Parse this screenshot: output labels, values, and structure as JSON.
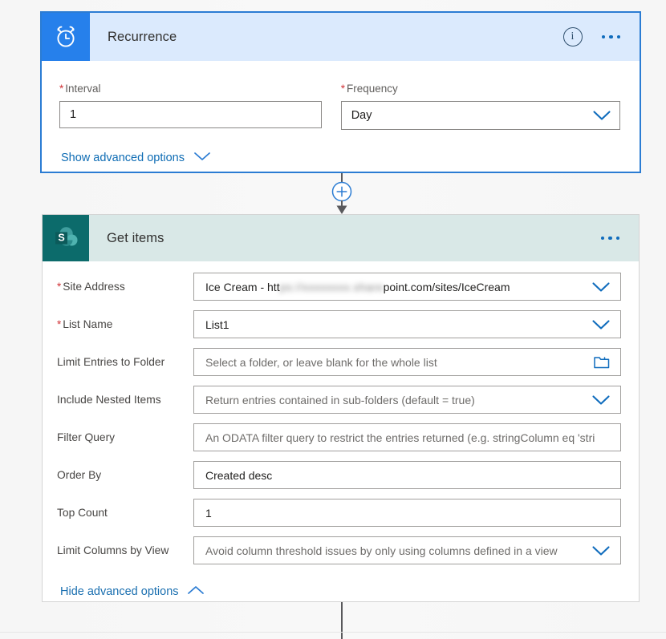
{
  "flow": {
    "recurrence": {
      "title": "Recurrence",
      "icon": "alarm-clock-icon",
      "icon_bg": "#2680eb",
      "header_bg": "#dbeafd",
      "border_color": "#2b7cd3",
      "info_icon": "info-icon",
      "more_icon": "ellipsis-icon",
      "fields": {
        "interval": {
          "label": "Interval",
          "required": true,
          "value": "1",
          "type": "text"
        },
        "frequency": {
          "label": "Frequency",
          "required": true,
          "value": "Day",
          "type": "dropdown"
        }
      },
      "advanced_link": {
        "label": "Show advanced options",
        "chevron": "chevron-down-icon"
      }
    },
    "connector": {
      "add_button_icon": "plus-circle-icon",
      "arrow_icon": "arrow-down-icon",
      "accent": "#2b7cd3"
    },
    "get_items": {
      "title": "Get items",
      "icon": "sharepoint-icon",
      "icon_bg": "#0c6b6b",
      "header_bg": "#d9e8e7",
      "more_icon": "ellipsis-icon",
      "rows": [
        {
          "label": "Site Address",
          "required": true,
          "value_prefix": "Ice Cream - htt",
          "value_redacted": "ps://xxxxxxxx.share",
          "value_suffix": "point.com/sites/IceCream",
          "control": "dropdown",
          "filled": true
        },
        {
          "label": "List Name",
          "required": true,
          "value": "List1",
          "control": "dropdown",
          "filled": true
        },
        {
          "label": "Limit Entries to Folder",
          "required": false,
          "value": "Select a folder, or leave blank for the whole list",
          "control": "folder-picker",
          "filled": false
        },
        {
          "label": "Include Nested Items",
          "required": false,
          "value": "Return entries contained in sub-folders (default = true)",
          "control": "dropdown",
          "filled": false
        },
        {
          "label": "Filter Query",
          "required": false,
          "value": "An ODATA filter query to restrict the entries returned (e.g. stringColumn eq 'stri",
          "control": "text",
          "filled": false
        },
        {
          "label": "Order By",
          "required": false,
          "value": "Created desc",
          "control": "text",
          "filled": true
        },
        {
          "label": "Top Count",
          "required": false,
          "value": "1",
          "control": "text",
          "filled": true
        },
        {
          "label": "Limit Columns by View",
          "required": false,
          "value": "Avoid column threshold issues by only using columns defined in a view",
          "control": "dropdown",
          "filled": false
        }
      ],
      "advanced_link": {
        "label": "Hide advanced options",
        "chevron": "chevron-up-icon"
      }
    }
  },
  "colors": {
    "accent_blue": "#2680eb",
    "link_blue": "#0e6cb4",
    "required_red": "#d13438",
    "sharepoint_teal": "#0c6b6b"
  }
}
